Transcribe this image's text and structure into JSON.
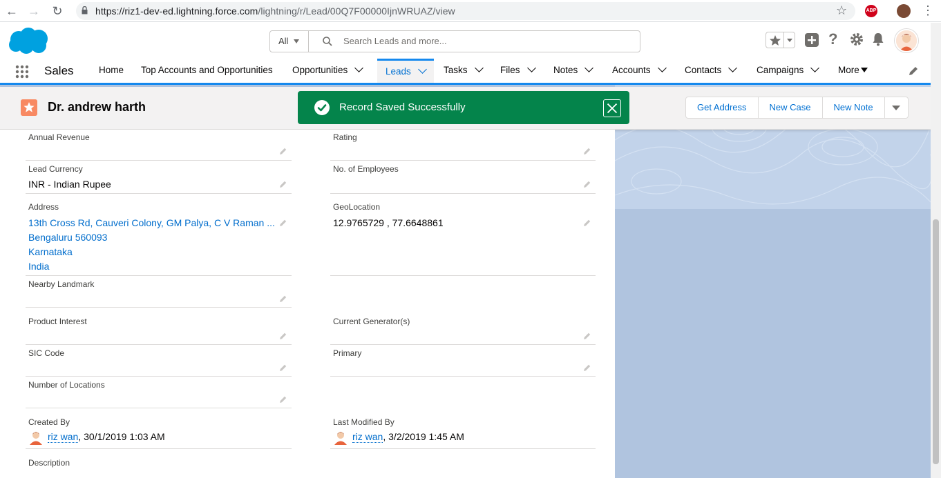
{
  "browser": {
    "url_host": "https://riz1-dev-ed.lightning.force.com",
    "url_path": "/lightning/r/Lead/00Q7F00000IjnWRUAZ/view",
    "adblock_label": "ABP"
  },
  "header": {
    "search_scope": "All",
    "search_placeholder": "Search Leads and more..."
  },
  "nav": {
    "app_name": "Sales",
    "items": [
      {
        "label": "Home"
      },
      {
        "label": "Top Accounts and Opportunities"
      },
      {
        "label": "Opportunities"
      },
      {
        "label": "Leads"
      },
      {
        "label": "Tasks"
      },
      {
        "label": "Files"
      },
      {
        "label": "Notes"
      },
      {
        "label": "Accounts"
      },
      {
        "label": "Contacts"
      },
      {
        "label": "Campaigns"
      },
      {
        "label": "More"
      }
    ],
    "active": "Leads"
  },
  "record": {
    "title": "Dr. andrew harth",
    "actions": [
      "Get Address",
      "New Case",
      "New Note"
    ]
  },
  "toast": {
    "message": "Record Saved Successfully",
    "color": "#04844b"
  },
  "fields": {
    "annual_revenue": {
      "label": "Annual Revenue",
      "value": ""
    },
    "rating": {
      "label": "Rating",
      "value": ""
    },
    "lead_currency": {
      "label": "Lead Currency",
      "value": "INR - Indian Rupee"
    },
    "no_of_employees": {
      "label": "No. of Employees",
      "value": ""
    },
    "address": {
      "label": "Address",
      "lines": [
        "13th Cross Rd, Cauveri Colony, GM Palya, C V Raman ...",
        "Bengaluru 560093",
        "Karnataka",
        "India"
      ]
    },
    "geolocation": {
      "label": "GeoLocation",
      "value": "12.9765729 , 77.6648861"
    },
    "nearby_landmark": {
      "label": "Nearby Landmark",
      "value": ""
    },
    "product_interest": {
      "label": "Product Interest",
      "value": ""
    },
    "current_generators": {
      "label": "Current Generator(s)",
      "value": ""
    },
    "sic_code": {
      "label": "SIC Code",
      "value": ""
    },
    "primary": {
      "label": "Primary",
      "value": ""
    },
    "number_of_locations": {
      "label": "Number of Locations",
      "value": ""
    },
    "created_by": {
      "label": "Created By",
      "user": "riz wan",
      "date": ", 30/1/2019 1:03 AM"
    },
    "last_modified_by": {
      "label": "Last Modified By",
      "user": "riz wan",
      "date": ", 3/2/2019 1:45 AM"
    },
    "description": {
      "label": "Description",
      "value": ""
    }
  },
  "colors": {
    "brand_blue": "#1589ee",
    "link": "#006dcc",
    "page_bg": "#b0c4df",
    "lead_icon": "#f88962"
  }
}
